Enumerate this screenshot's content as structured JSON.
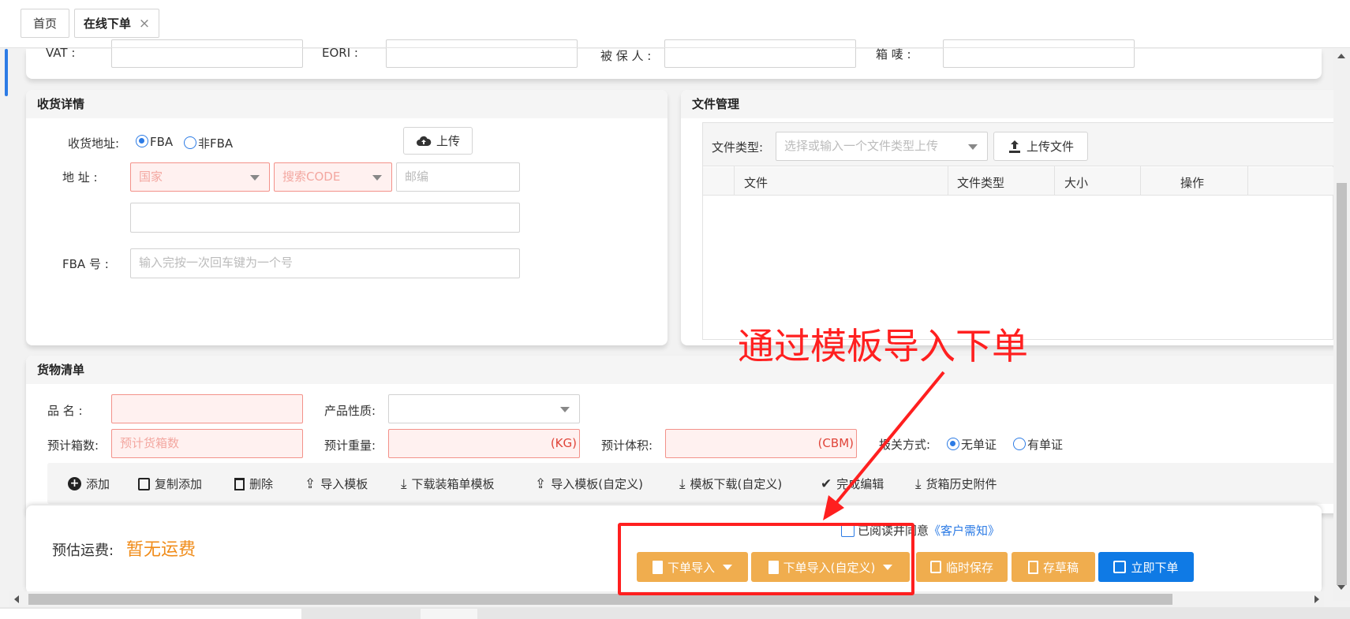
{
  "tabs": {
    "home": "首页",
    "active": "在线下单",
    "close": "×"
  },
  "top_row": {
    "vat": "VAT    :",
    "eori": "EORI    :",
    "insured": "被 保 人 :",
    "box": "箱    唛    :"
  },
  "receive": {
    "title": "收货详情",
    "address_label": "收货地址:",
    "fba": "FBA",
    "non_fba": "非FBA",
    "upload": "上传",
    "addr_label": "地    址    :",
    "country_ph": "国家",
    "code_ph": "搜索CODE",
    "zip_ph": "邮编",
    "fba_no_label": "FBA  号 :",
    "fba_no_ph": "输入完按一次回车键为一个号"
  },
  "files": {
    "title": "文件管理",
    "type_label": "文件类型:",
    "type_ph": "选择或输入一个文件类型上传",
    "upload_btn": "上传文件",
    "columns": [
      "文件",
      "文件类型",
      "大小",
      "操作"
    ]
  },
  "goods": {
    "title": "货物清单",
    "name_label": "品    名    :",
    "nature_label": "产品性质:",
    "boxes_label": "预计箱数:",
    "boxes_ph": "预计货箱数",
    "weight_label": "预计重量:",
    "weight_unit": "(KG)",
    "volume_label": "预计体积:",
    "volume_unit": "(CBM)",
    "customs_label": "报关方式:",
    "no_doc": "无单证",
    "with_doc": "有单证"
  },
  "toolbar": [
    "添加",
    "复制添加",
    "删除",
    "导入模板",
    "下载装箱单模板",
    "导入模板(自定义)",
    "模板下载(自定义)",
    "完成编辑",
    "货箱历史附件"
  ],
  "footer": {
    "freight_label": "预估运费:",
    "freight_value": "暂无运费",
    "agree": "已阅读并同意",
    "notice": "《客户需知》",
    "btn_import": "下单导入",
    "btn_import_custom": "下单导入(自定义)",
    "btn_temp_save": "临时保存",
    "btn_draft": "存草稿",
    "btn_submit": "立即下单"
  },
  "annotation": {
    "text": "通过模板导入下单"
  },
  "colors": {
    "accent": "#2c7be5",
    "orange": "#f0ad4e",
    "blue": "#0f7ae5",
    "annotation": "#ff1f1f"
  }
}
